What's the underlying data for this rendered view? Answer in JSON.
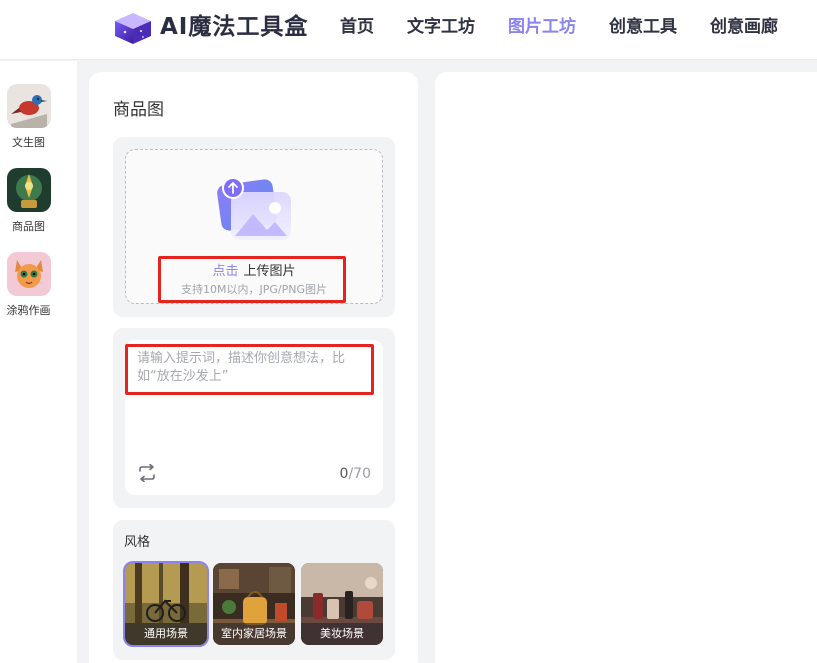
{
  "header": {
    "brand": "AI魔法工具盒",
    "nav": [
      {
        "label": "首页",
        "active": false
      },
      {
        "label": "文字工坊",
        "active": false
      },
      {
        "label": "图片工坊",
        "active": true
      },
      {
        "label": "创意工具",
        "active": false
      },
      {
        "label": "创意画廊",
        "active": false
      }
    ]
  },
  "sidebar": {
    "items": [
      {
        "label": "文生图",
        "icon": "bird-thumbnail"
      },
      {
        "label": "商品图",
        "icon": "product-thumbnail"
      },
      {
        "label": "涂鸦作画",
        "icon": "cat-thumbnail"
      }
    ]
  },
  "panel": {
    "title": "商品图",
    "upload": {
      "link_text": "点击",
      "action_text": "上传图片",
      "hint": "支持10M以内，JPG/PNG图片"
    },
    "prompt": {
      "placeholder": "请输入提示词，描述你创意想法，比如“放在沙发上”",
      "value": "",
      "count": "0",
      "max": "/70"
    },
    "style": {
      "title": "风格",
      "options": [
        {
          "label": "通用场景",
          "selected": true
        },
        {
          "label": "室内家居场景",
          "selected": false
        },
        {
          "label": "美妆场景",
          "selected": false
        }
      ]
    }
  },
  "colors": {
    "accent": "#8b83f0",
    "highlight": "#e52420",
    "panel_bg": "#f2f3f5"
  }
}
